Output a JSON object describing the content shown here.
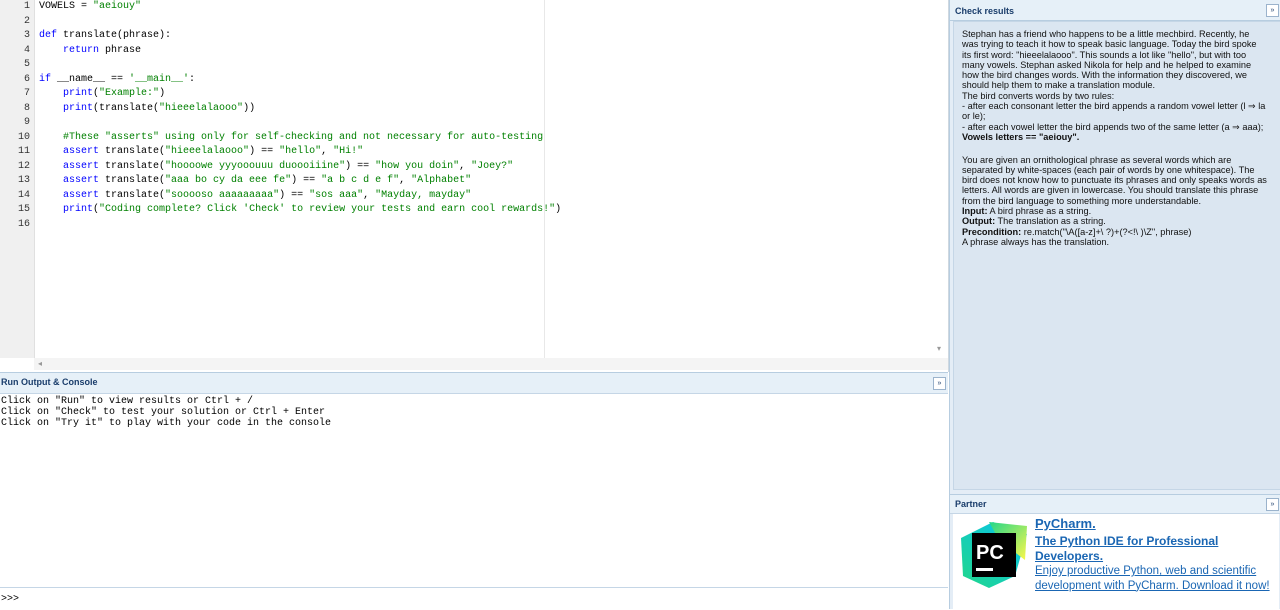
{
  "editor": {
    "line_numbers": [
      "1",
      "2",
      "3",
      "4",
      "5",
      "6",
      "7",
      "8",
      "9",
      "10",
      "11",
      "12",
      "13",
      "14",
      "15",
      "16"
    ],
    "lines": [
      [
        {
          "t": "VOWELS = ",
          "c": ""
        },
        {
          "t": "\"aeiouy\"",
          "c": "st"
        }
      ],
      [],
      [
        {
          "t": "def",
          "c": "kw"
        },
        {
          "t": " translate(phrase):",
          "c": ""
        }
      ],
      [
        {
          "t": "    ",
          "c": ""
        },
        {
          "t": "return",
          "c": "kw"
        },
        {
          "t": " phrase",
          "c": ""
        }
      ],
      [],
      [
        {
          "t": "if",
          "c": "kw"
        },
        {
          "t": " __name__ == ",
          "c": ""
        },
        {
          "t": "'__main__'",
          "c": "st"
        },
        {
          "t": ":",
          "c": ""
        }
      ],
      [
        {
          "t": "    ",
          "c": ""
        },
        {
          "t": "print",
          "c": "bi"
        },
        {
          "t": "(",
          "c": ""
        },
        {
          "t": "\"Example:\"",
          "c": "st"
        },
        {
          "t": ")",
          "c": ""
        }
      ],
      [
        {
          "t": "    ",
          "c": ""
        },
        {
          "t": "print",
          "c": "bi"
        },
        {
          "t": "(translate(",
          "c": ""
        },
        {
          "t": "\"hieeelalaooo\"",
          "c": "st"
        },
        {
          "t": "))",
          "c": ""
        }
      ],
      [],
      [
        {
          "t": "    #These \"asserts\" using only for self-checking and not necessary for auto-testing",
          "c": "cm"
        }
      ],
      [
        {
          "t": "    ",
          "c": ""
        },
        {
          "t": "assert",
          "c": "kw"
        },
        {
          "t": " translate(",
          "c": ""
        },
        {
          "t": "\"hieeelalaooo\"",
          "c": "st"
        },
        {
          "t": ") == ",
          "c": ""
        },
        {
          "t": "\"hello\"",
          "c": "st"
        },
        {
          "t": ", ",
          "c": ""
        },
        {
          "t": "\"Hi!\"",
          "c": "st"
        }
      ],
      [
        {
          "t": "    ",
          "c": ""
        },
        {
          "t": "assert",
          "c": "kw"
        },
        {
          "t": " translate(",
          "c": ""
        },
        {
          "t": "\"hoooowe yyyooouuu duoooiiine\"",
          "c": "st"
        },
        {
          "t": ") == ",
          "c": ""
        },
        {
          "t": "\"how you doin\"",
          "c": "st"
        },
        {
          "t": ", ",
          "c": ""
        },
        {
          "t": "\"Joey?\"",
          "c": "st"
        }
      ],
      [
        {
          "t": "    ",
          "c": ""
        },
        {
          "t": "assert",
          "c": "kw"
        },
        {
          "t": " translate(",
          "c": ""
        },
        {
          "t": "\"aaa bo cy da eee fe\"",
          "c": "st"
        },
        {
          "t": ") == ",
          "c": ""
        },
        {
          "t": "\"a b c d e f\"",
          "c": "st"
        },
        {
          "t": ", ",
          "c": ""
        },
        {
          "t": "\"Alphabet\"",
          "c": "st"
        }
      ],
      [
        {
          "t": "    ",
          "c": ""
        },
        {
          "t": "assert",
          "c": "kw"
        },
        {
          "t": " translate(",
          "c": ""
        },
        {
          "t": "\"sooooso aaaaaaaaa\"",
          "c": "st"
        },
        {
          "t": ") == ",
          "c": ""
        },
        {
          "t": "\"sos aaa\"",
          "c": "st"
        },
        {
          "t": ", ",
          "c": ""
        },
        {
          "t": "\"Mayday, mayday\"",
          "c": "st"
        }
      ],
      [
        {
          "t": "    ",
          "c": ""
        },
        {
          "t": "print",
          "c": "bi"
        },
        {
          "t": "(",
          "c": ""
        },
        {
          "t": "\"Coding complete? Click 'Check' to review your tests and earn cool rewards!\"",
          "c": "st"
        },
        {
          "t": ")",
          "c": ""
        }
      ],
      []
    ]
  },
  "console": {
    "title": "Run Output & Console",
    "lines": [
      "Click on \"Run\" to view results or Ctrl + /",
      "Click on \"Check\" to test your solution or Ctrl + Enter",
      "Click on \"Try it\" to play with your code in the console"
    ],
    "prompt": ">>>"
  },
  "check": {
    "title": "Check results",
    "paragraphs": [
      {
        "text": "Stephan has a friend who happens to be a little mechbird. Recently, he was trying to teach it how to speak basic language. Today the bird spoke its first word: \"hieeelalaooo\". This sounds a lot like \"hello\", but with too many vowels. Stephan asked Nikola for help and he helped to examine how the bird changes words. With the information they discovered, we should help them to make a translation module."
      },
      {
        "text": "The bird converts words by two rules:"
      },
      {
        "text": "- after each consonant letter the bird appends a random vowel letter (l ⇒ la or le);"
      },
      {
        "text": "- after each vowel letter the bird appends two of the same letter (a ⇒ aaa);"
      },
      {
        "bold": "Vowels letters == \"aeiouy\".",
        "text": ""
      },
      {
        "text": " "
      },
      {
        "text": "You are given an ornithological phrase as several words which are separated by white-spaces (each pair of words by one whitespace). The bird does not know how to punctuate its phrases and only speaks words as letters. All words are given in lowercase. You should translate this phrase from the bird language to something more understandable."
      },
      {
        "bold": "Input:",
        "text": " A bird phrase as a string."
      },
      {
        "bold": "Output:",
        "text": " The translation as a string."
      },
      {
        "bold": "Precondition:",
        "text": " re.match(\"\\A([a-z]+\\ ?)+(?<!\\ )\\Z\", phrase)"
      },
      {
        "text": "A phrase always has the translation."
      }
    ]
  },
  "partner": {
    "title": "Partner",
    "name": "PyCharm.",
    "tagline": "The Python IDE for Professional Developers.",
    "description": "Enjoy productive Python, web and scientific development with PyCharm. Download it now!",
    "logo_text": "PC"
  },
  "icons": {
    "collapse": "»",
    "scroll_left": "◂",
    "scroll_down": "▾"
  }
}
